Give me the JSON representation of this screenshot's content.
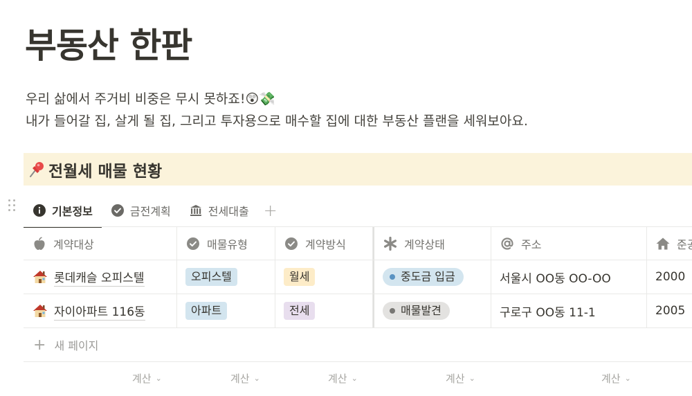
{
  "page": {
    "title": "부동산 한판",
    "intro_line1": "우리 삶에서 주거비 비중은 무시 못하죠!😲💸",
    "intro_line2": "내가 들어갈 집, 살게 될 집, 그리고 투자용으로 매수할 집에 대한 부동산 플랜을 세워보아요."
  },
  "callout": {
    "icon": "pushpin-icon",
    "heading": "전월세 매물 현황",
    "background": "#fbf3db"
  },
  "tabs": [
    {
      "label": "기본정보",
      "icon": "info-icon",
      "active": true
    },
    {
      "label": "금전계획",
      "icon": "check-circle-icon",
      "active": false
    },
    {
      "label": "전세대출",
      "icon": "bank-icon",
      "active": false
    }
  ],
  "table": {
    "columns": [
      {
        "label": "계약대상",
        "icon": "apple-icon"
      },
      {
        "label": "매물유형",
        "icon": "check-circle-icon"
      },
      {
        "label": "계약방식",
        "icon": "check-circle-icon"
      },
      {
        "label": "계약상태",
        "icon": "asterisk-icon"
      },
      {
        "label": "주소",
        "icon": "at-icon"
      },
      {
        "label": "준공",
        "icon": "home-icon"
      }
    ],
    "rows": [
      {
        "title": "롯데캐슬 오피스텔",
        "icon": "house-icon",
        "type": "오피스텔",
        "method": "월세",
        "status": "중도금 입금",
        "address": "서울시 OO동 OO-OO",
        "built": "2000"
      },
      {
        "title": "자이아파트 116동",
        "icon": "house-icon",
        "type": "아파트",
        "method": "전세",
        "status": "매물발견",
        "address": "구로구 OO동 11-1",
        "built": "2005"
      }
    ],
    "new_page_label": "새 페이지",
    "calc_label": "계산"
  },
  "colors": {
    "tag_blue_bg": "#d3e5ef",
    "tag_yellow_bg": "#fdecc8",
    "tag_purple_bg": "#e8deee",
    "status_blue_bg": "#d3e5ef",
    "status_blue_dot": "#5a93c2",
    "status_gray_bg": "#e3e2e0",
    "status_gray_dot": "#787774"
  }
}
